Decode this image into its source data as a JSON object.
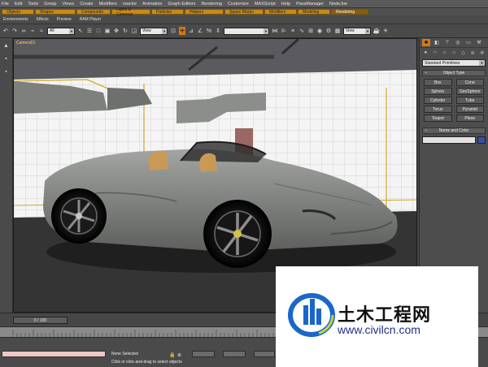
{
  "menu": {
    "items": [
      "File",
      "Edit",
      "Tools",
      "Group",
      "Views",
      "Create",
      "Modifiers",
      "reactor",
      "Animation",
      "Graph Editors",
      "Rendering",
      "Customize",
      "MAXScript",
      "Help",
      "PassManager",
      "NodeJoe"
    ]
  },
  "tabs": [
    "Objects",
    "Shapes",
    "Compounds",
    "Lights & Cameras",
    "Particles",
    "Helpers",
    "Space Warps",
    "Modifiers",
    "Modeling",
    "Rendering"
  ],
  "active_tab": "Rendering",
  "subtoolbar": [
    "Environments",
    "Effects",
    "Preview",
    "RAM Player"
  ],
  "toolbar": {
    "filter_value": "All",
    "view_value": "View",
    "view2_value": "View"
  },
  "viewport": {
    "label": "Camera01"
  },
  "command_panel": {
    "dropdown_value": "Standard Primitives",
    "object_type_title": "Object Type",
    "buttons": [
      "Box",
      "Cone",
      "Sphere",
      "GeoSphere",
      "Cylinder",
      "Tube",
      "Torus",
      "Pyramid",
      "Teapot",
      "Plane"
    ],
    "name_color_title": "Name and Color",
    "color_swatch": "#3b4da8"
  },
  "timeline": {
    "slider_label": "0 / 100"
  },
  "statusbar": {
    "selection": "None Selected",
    "prompt": "Click or click-and-drag to select objects"
  },
  "watermark": {
    "title": "土木工程网",
    "url": "www.civilcn.com"
  },
  "colors": {
    "accent_orange": "#d47a10",
    "tab_orange": "#c98a14",
    "car_body": "#8d8f8d",
    "interior_tan": "#c89a56"
  }
}
